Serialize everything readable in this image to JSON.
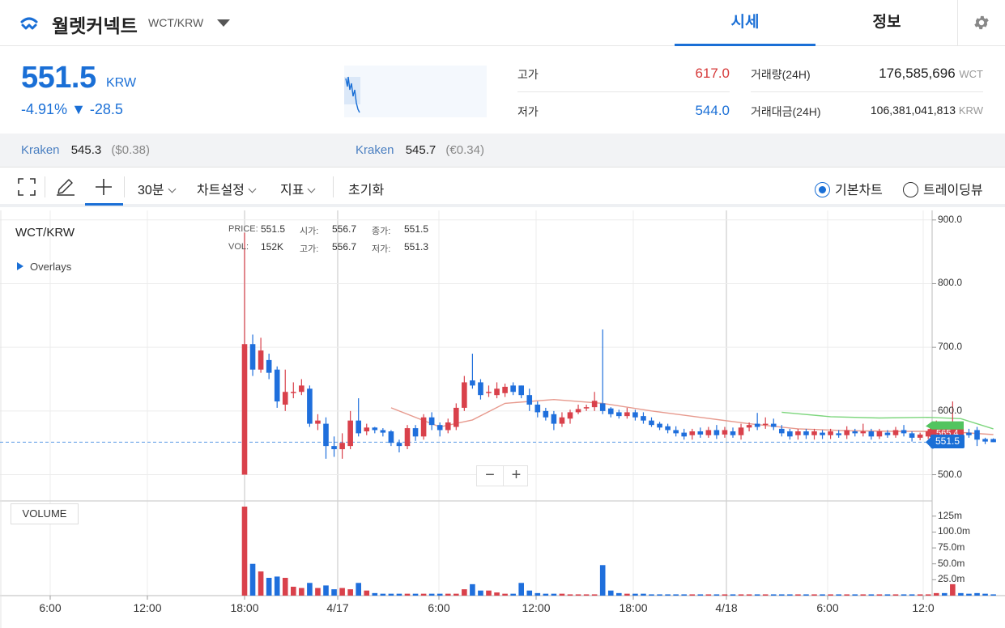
{
  "header": {
    "coin_name": "월렛커넥트",
    "pair": "WCT/KRW",
    "tab_market": "시세",
    "tab_info": "정보"
  },
  "summary": {
    "price": "551.5",
    "unit": "KRW",
    "change_pct": "-4.91%",
    "change_abs": "▼ -28.5",
    "high_label": "고가",
    "high_value": "617.0",
    "low_label": "저가",
    "low_value": "544.0",
    "volume_label": "거래량(24H)",
    "volume_value": "176,585,696",
    "volume_unit": "WCT",
    "amount_label": "거래대금(24H)",
    "amount_value": "106,381,041,813",
    "amount_unit": "KRW"
  },
  "exchanges": [
    {
      "name": "Kraken",
      "price": "545.3",
      "sub": "($0.38)"
    },
    {
      "name": "Kraken",
      "price": "545.7",
      "sub": "(€0.34)"
    }
  ],
  "toolbar": {
    "interval": "30분",
    "chart_settings": "차트설정",
    "indicators": "지표",
    "reset": "초기화",
    "radio_basic": "기본차트",
    "radio_tradingview": "트레이딩뷰"
  },
  "chart": {
    "pair": "WCT/KRW",
    "overlays": "Overlays",
    "ohlc": {
      "price_label": "PRICE:",
      "price": "551.5",
      "open_label": "시가:",
      "open": "556.7",
      "close_label": "종가:",
      "close": "551.5",
      "vol_label": "VOL:",
      "vol": "152K",
      "high_label": "고가:",
      "high": "556.7",
      "low_label": "저가:",
      "low": "551.3"
    },
    "tag_prev": "565.4",
    "tag_current": "551.5",
    "volume_label": "VOLUME",
    "zoom_minus": "−",
    "zoom_plus": "+"
  },
  "chart_data": {
    "type": "candlestick",
    "y_ticks": [
      "900.0",
      "800.0",
      "700.0",
      "600.0",
      "500.0"
    ],
    "y_tick_values": [
      900,
      800,
      700,
      600,
      500
    ],
    "volume_ticks": [
      "125m",
      "100.0m",
      "75.0m",
      "50.0m",
      "25.0m"
    ],
    "volume_tick_values": [
      125,
      100,
      75,
      50,
      25
    ],
    "x_ticks": [
      "6:00",
      "12:00",
      "18:00",
      "4/17",
      "6:00",
      "12:00",
      "18:00",
      "4/18",
      "6:00",
      "12:0"
    ],
    "ylim": [
      460,
      915
    ],
    "vol_ylim": [
      0,
      140
    ],
    "candles": [
      {
        "o": 500,
        "c": 705,
        "h": 880,
        "l": 500,
        "v": 140
      },
      {
        "o": 705,
        "c": 665,
        "h": 720,
        "l": 655,
        "v": 50
      },
      {
        "o": 665,
        "c": 695,
        "h": 715,
        "l": 660,
        "v": 38
      },
      {
        "o": 680,
        "c": 660,
        "h": 690,
        "l": 650,
        "v": 28
      },
      {
        "o": 665,
        "c": 615,
        "h": 670,
        "l": 605,
        "v": 30
      },
      {
        "o": 610,
        "c": 630,
        "h": 665,
        "l": 600,
        "v": 28
      },
      {
        "o": 630,
        "c": 630,
        "h": 645,
        "l": 620,
        "v": 14
      },
      {
        "o": 630,
        "c": 640,
        "h": 650,
        "l": 625,
        "v": 12
      },
      {
        "o": 635,
        "c": 580,
        "h": 640,
        "l": 575,
        "v": 20
      },
      {
        "o": 580,
        "c": 585,
        "h": 595,
        "l": 570,
        "v": 12
      },
      {
        "o": 580,
        "c": 545,
        "h": 590,
        "l": 525,
        "v": 16
      },
      {
        "o": 545,
        "c": 540,
        "h": 560,
        "l": 528,
        "v": 10
      },
      {
        "o": 540,
        "c": 550,
        "h": 565,
        "l": 525,
        "v": 12
      },
      {
        "o": 545,
        "c": 585,
        "h": 600,
        "l": 540,
        "v": 10
      },
      {
        "o": 585,
        "c": 565,
        "h": 620,
        "l": 560,
        "v": 20
      },
      {
        "o": 568,
        "c": 574,
        "h": 580,
        "l": 562,
        "v": 8
      },
      {
        "o": 574,
        "c": 570,
        "h": 575,
        "l": 565,
        "v": 4
      },
      {
        "o": 570,
        "c": 566,
        "h": 573,
        "l": 560,
        "v": 3
      },
      {
        "o": 568,
        "c": 550,
        "h": 570,
        "l": 545,
        "v": 3
      },
      {
        "o": 550,
        "c": 545,
        "h": 555,
        "l": 535,
        "v": 3
      },
      {
        "o": 545,
        "c": 573,
        "h": 578,
        "l": 540,
        "v": 3
      },
      {
        "o": 573,
        "c": 560,
        "h": 578,
        "l": 553,
        "v": 3
      },
      {
        "o": 560,
        "c": 590,
        "h": 595,
        "l": 555,
        "v": 3
      },
      {
        "o": 590,
        "c": 578,
        "h": 598,
        "l": 570,
        "v": 3
      },
      {
        "o": 578,
        "c": 570,
        "h": 582,
        "l": 560,
        "v": 3
      },
      {
        "o": 570,
        "c": 582,
        "h": 588,
        "l": 565,
        "v": 3
      },
      {
        "o": 575,
        "c": 605,
        "h": 612,
        "l": 570,
        "v": 3
      },
      {
        "o": 605,
        "c": 645,
        "h": 655,
        "l": 600,
        "v": 10
      },
      {
        "o": 648,
        "c": 640,
        "h": 690,
        "l": 635,
        "v": 18
      },
      {
        "o": 645,
        "c": 625,
        "h": 650,
        "l": 618,
        "v": 8
      },
      {
        "o": 630,
        "c": 630,
        "h": 640,
        "l": 622,
        "v": 8
      },
      {
        "o": 625,
        "c": 635,
        "h": 645,
        "l": 620,
        "v": 5
      },
      {
        "o": 628,
        "c": 638,
        "h": 643,
        "l": 622,
        "v": 3
      },
      {
        "o": 640,
        "c": 630,
        "h": 645,
        "l": 625,
        "v": 3
      },
      {
        "o": 640,
        "c": 625,
        "h": 640,
        "l": 620,
        "v": 20
      },
      {
        "o": 625,
        "c": 610,
        "h": 635,
        "l": 600,
        "v": 8
      },
      {
        "o": 610,
        "c": 598,
        "h": 615,
        "l": 590,
        "v": 4
      },
      {
        "o": 600,
        "c": 590,
        "h": 605,
        "l": 585,
        "v": 3
      },
      {
        "o": 595,
        "c": 580,
        "h": 600,
        "l": 570,
        "v": 3
      },
      {
        "o": 580,
        "c": 590,
        "h": 598,
        "l": 575,
        "v": 3
      },
      {
        "o": 588,
        "c": 598,
        "h": 602,
        "l": 580,
        "v": 2
      },
      {
        "o": 598,
        "c": 603,
        "h": 610,
        "l": 595,
        "v": 2
      },
      {
        "o": 604,
        "c": 606,
        "h": 610,
        "l": 600,
        "v": 2
      },
      {
        "o": 606,
        "c": 616,
        "h": 630,
        "l": 600,
        "v": 2
      },
      {
        "o": 612,
        "c": 600,
        "h": 728,
        "l": 595,
        "v": 48
      },
      {
        "o": 604,
        "c": 595,
        "h": 606,
        "l": 590,
        "v": 8
      },
      {
        "o": 598,
        "c": 592,
        "h": 602,
        "l": 588,
        "v": 4
      },
      {
        "o": 592,
        "c": 598,
        "h": 605,
        "l": 588,
        "v": 3
      },
      {
        "o": 598,
        "c": 590,
        "h": 602,
        "l": 585,
        "v": 3
      },
      {
        "o": 592,
        "c": 585,
        "h": 598,
        "l": 580,
        "v": 3
      },
      {
        "o": 585,
        "c": 578,
        "h": 590,
        "l": 575,
        "v": 2
      },
      {
        "o": 580,
        "c": 574,
        "h": 583,
        "l": 570,
        "v": 2
      },
      {
        "o": 576,
        "c": 570,
        "h": 580,
        "l": 565,
        "v": 2
      },
      {
        "o": 570,
        "c": 565,
        "h": 576,
        "l": 560,
        "v": 2
      },
      {
        "o": 566,
        "c": 560,
        "h": 572,
        "l": 555,
        "v": 2
      },
      {
        "o": 562,
        "c": 568,
        "h": 572,
        "l": 555,
        "v": 2
      },
      {
        "o": 568,
        "c": 563,
        "h": 574,
        "l": 558,
        "v": 2
      },
      {
        "o": 562,
        "c": 570,
        "h": 575,
        "l": 558,
        "v": 2
      },
      {
        "o": 570,
        "c": 562,
        "h": 578,
        "l": 556,
        "v": 2
      },
      {
        "o": 563,
        "c": 570,
        "h": 575,
        "l": 558,
        "v": 2
      },
      {
        "o": 568,
        "c": 562,
        "h": 574,
        "l": 558,
        "v": 2
      },
      {
        "o": 562,
        "c": 574,
        "h": 580,
        "l": 555,
        "v": 2
      },
      {
        "o": 574,
        "c": 578,
        "h": 582,
        "l": 568,
        "v": 2
      },
      {
        "o": 580,
        "c": 575,
        "h": 597,
        "l": 570,
        "v": 2
      },
      {
        "o": 578,
        "c": 580,
        "h": 590,
        "l": 572,
        "v": 2
      },
      {
        "o": 580,
        "c": 575,
        "h": 588,
        "l": 570,
        "v": 2
      },
      {
        "o": 572,
        "c": 565,
        "h": 578,
        "l": 560,
        "v": 2
      },
      {
        "o": 568,
        "c": 560,
        "h": 572,
        "l": 555,
        "v": 2
      },
      {
        "o": 562,
        "c": 568,
        "h": 572,
        "l": 555,
        "v": 2
      },
      {
        "o": 568,
        "c": 562,
        "h": 572,
        "l": 556,
        "v": 2
      },
      {
        "o": 562,
        "c": 568,
        "h": 572,
        "l": 555,
        "v": 2
      },
      {
        "o": 566,
        "c": 562,
        "h": 570,
        "l": 556,
        "v": 2
      },
      {
        "o": 562,
        "c": 568,
        "h": 572,
        "l": 556,
        "v": 2
      },
      {
        "o": 565,
        "c": 562,
        "h": 570,
        "l": 558,
        "v": 2
      },
      {
        "o": 562,
        "c": 570,
        "h": 576,
        "l": 556,
        "v": 2
      },
      {
        "o": 568,
        "c": 565,
        "h": 572,
        "l": 560,
        "v": 2
      },
      {
        "o": 565,
        "c": 568,
        "h": 580,
        "l": 560,
        "v": 2
      },
      {
        "o": 568,
        "c": 560,
        "h": 572,
        "l": 555,
        "v": 2
      },
      {
        "o": 560,
        "c": 568,
        "h": 572,
        "l": 556,
        "v": 2
      },
      {
        "o": 566,
        "c": 562,
        "h": 570,
        "l": 558,
        "v": 2
      },
      {
        "o": 562,
        "c": 570,
        "h": 575,
        "l": 558,
        "v": 2
      },
      {
        "o": 570,
        "c": 565,
        "h": 578,
        "l": 560,
        "v": 2
      },
      {
        "o": 565,
        "c": 558,
        "h": 568,
        "l": 552,
        "v": 2
      },
      {
        "o": 558,
        "c": 563,
        "h": 566,
        "l": 554,
        "v": 2
      },
      {
        "o": 560,
        "c": 568,
        "h": 572,
        "l": 556,
        "v": 2
      },
      {
        "o": 565,
        "c": 578,
        "h": 585,
        "l": 560,
        "v": 4
      },
      {
        "o": 578,
        "c": 568,
        "h": 582,
        "l": 562,
        "v": 4
      },
      {
        "o": 566,
        "c": 575,
        "h": 615,
        "l": 560,
        "v": 18
      },
      {
        "o": 570,
        "c": 565,
        "h": 576,
        "l": 560,
        "v": 4
      },
      {
        "o": 566,
        "c": 562,
        "h": 572,
        "l": 558,
        "v": 3
      },
      {
        "o": 570,
        "c": 555,
        "h": 575,
        "l": 545,
        "v": 4
      },
      {
        "o": 556,
        "c": 552,
        "h": 558,
        "l": 548,
        "v": 3
      },
      {
        "o": 556,
        "c": 551,
        "h": 557,
        "l": 551,
        "v": 2
      }
    ],
    "ma_long": [
      {
        "i": 18,
        "y": 605
      },
      {
        "i": 24,
        "y": 575
      },
      {
        "i": 28,
        "y": 586
      },
      {
        "i": 32,
        "y": 612
      },
      {
        "i": 38,
        "y": 618
      },
      {
        "i": 44,
        "y": 612
      },
      {
        "i": 50,
        "y": 600
      },
      {
        "i": 56,
        "y": 590
      },
      {
        "i": 62,
        "y": 580
      },
      {
        "i": 68,
        "y": 572
      },
      {
        "i": 74,
        "y": 569
      },
      {
        "i": 80,
        "y": 568
      },
      {
        "i": 86,
        "y": 568
      },
      {
        "i": 92,
        "y": 563
      }
    ],
    "ma_short": [
      {
        "i": 66,
        "y": 598
      },
      {
        "i": 72,
        "y": 591
      },
      {
        "i": 78,
        "y": 589
      },
      {
        "i": 84,
        "y": 590
      },
      {
        "i": 88,
        "y": 588
      },
      {
        "i": 92,
        "y": 572
      }
    ]
  }
}
